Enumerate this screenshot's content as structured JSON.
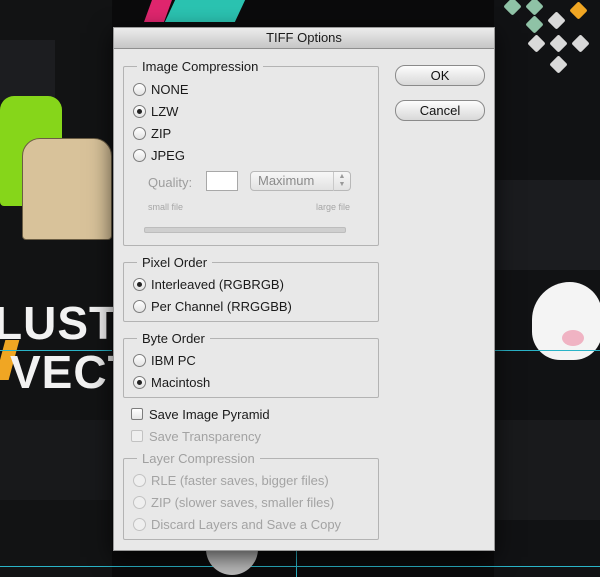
{
  "dialog": {
    "title": "TIFF Options"
  },
  "buttons": {
    "ok": "OK",
    "cancel": "Cancel"
  },
  "image_compression": {
    "legend": "Image Compression",
    "options": [
      "NONE",
      "LZW",
      "ZIP",
      "JPEG"
    ],
    "selected": "LZW",
    "quality": {
      "label": "Quality:",
      "value": "",
      "select_value": "Maximum",
      "min_label": "small file",
      "max_label": "large file"
    }
  },
  "pixel_order": {
    "legend": "Pixel Order",
    "options": [
      "Interleaved (RGBRGB)",
      "Per Channel (RRGGBB)"
    ],
    "selected": "Interleaved (RGBRGB)"
  },
  "byte_order": {
    "legend": "Byte Order",
    "options": [
      "IBM PC",
      "Macintosh"
    ],
    "selected": "Macintosh"
  },
  "checkboxes": {
    "save_image_pyramid": "Save Image Pyramid",
    "save_transparency": "Save Transparency"
  },
  "layer_compression": {
    "legend": "Layer Compression",
    "options": [
      "RLE (faster saves, bigger files)",
      "ZIP (slower saves, smaller files)",
      "Discard Layers and Save a Copy"
    ]
  },
  "background": {
    "text_line_1": "LUST",
    "text_line_2": "VECT"
  },
  "colors": {
    "accent_guides": "#2ab4c8",
    "dialog_bg": "#e8e8e8",
    "green_shirt": "#86d61a",
    "tan_shirt": "#d8c29a"
  }
}
